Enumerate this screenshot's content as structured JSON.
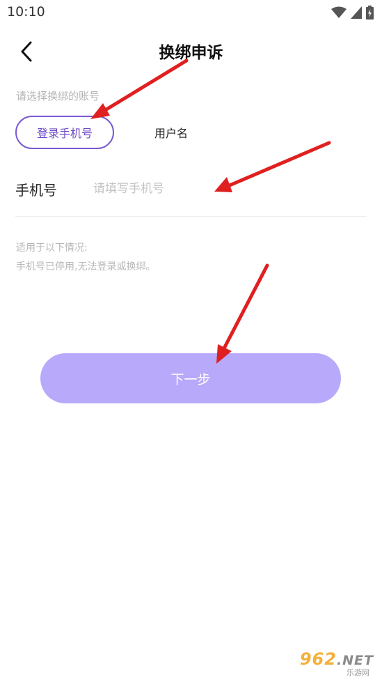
{
  "status_bar": {
    "time": "10:10",
    "icons": [
      "wifi-icon",
      "cell-signal-icon",
      "battery-charging-icon"
    ]
  },
  "nav": {
    "back_icon": "chevron-left-icon",
    "title": "换绑申诉"
  },
  "account_select": {
    "hint": "请选择换绑的账号",
    "tabs": [
      {
        "label": "登录手机号",
        "active": true
      },
      {
        "label": "用户名",
        "active": false
      }
    ]
  },
  "phone_field": {
    "label": "手机号",
    "value": "",
    "placeholder": "请填写手机号"
  },
  "notice": {
    "line1": "适用于以下情况:",
    "line2": "手机号已停用,无法登录或换绑。"
  },
  "next_button": {
    "label": "下一步"
  },
  "watermark": {
    "main": "962",
    "net": ".NET",
    "sub": "乐游网"
  },
  "colors": {
    "accent": "#7a5ad1",
    "button_bg": "#b8a9fb",
    "arrow": "#e02020",
    "hint_text": "#b3b3b3"
  }
}
